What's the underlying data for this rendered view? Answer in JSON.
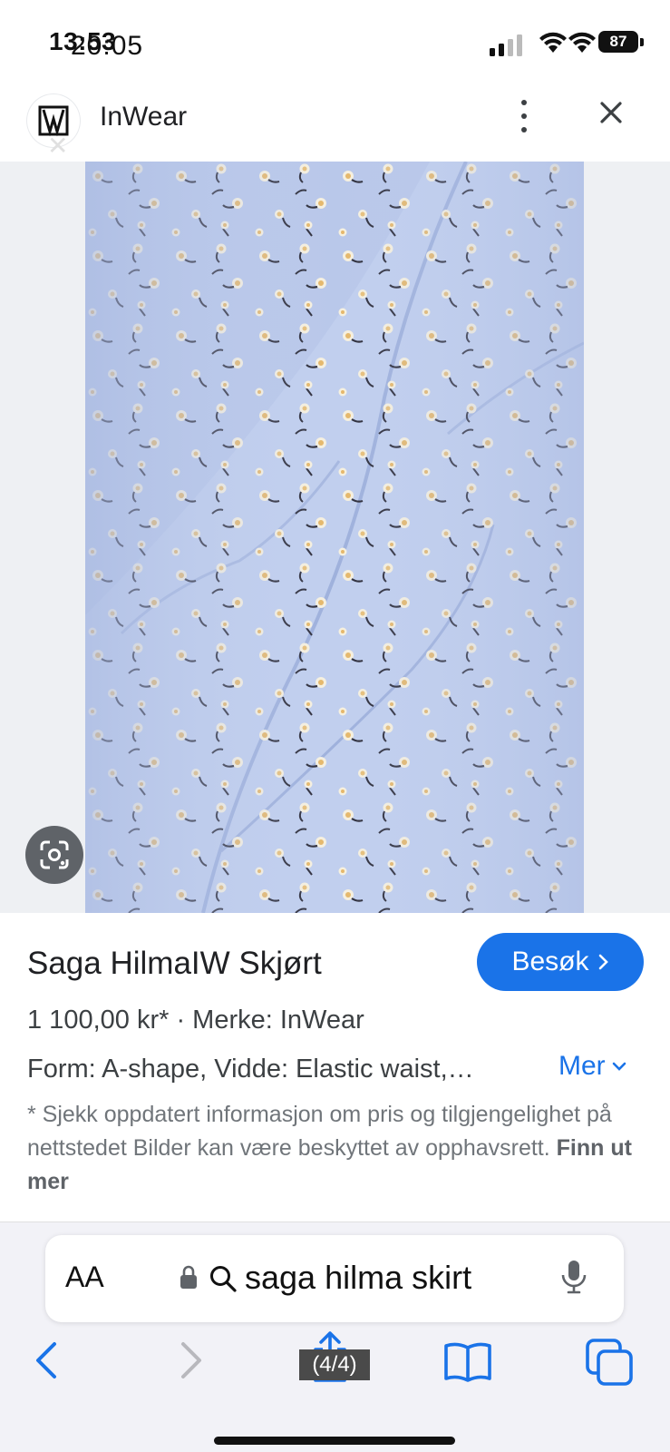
{
  "status_bar": {
    "time_overlay_a": "13:53",
    "time_overlay_b": "20:05",
    "battery": "87"
  },
  "header": {
    "site_name": "InWear"
  },
  "product": {
    "title": "Saga HilmaIW Skjørt",
    "visit_label": "Besøk",
    "price_line": "1 100,00 kr* · Merke: InWear",
    "form_line": "Form: A-shape, Vidde: Elastic waist,…",
    "more_label": "Mer",
    "disclaimer_text": "* Sjekk oppdatert informasjon om pris og tilgjengelighet på nettstedet Bilder kan være beskyttet av opphavsrett. ",
    "disclaimer_link": "Finn ut mer"
  },
  "browser": {
    "aa_label": "AA",
    "url_text": "saga hilma skirt",
    "page_counter": "(4/4)"
  },
  "colors": {
    "accent": "#1a73e8",
    "fabric": "#b9c8ea"
  },
  "icons": [
    "wifi-icon",
    "signal-icon",
    "battery-icon",
    "kebab-menu-icon",
    "close-icon",
    "google-lens-icon",
    "chevron-right-icon",
    "chevron-down-icon",
    "lock-icon",
    "search-icon",
    "microphone-icon",
    "back-arrow-icon",
    "forward-arrow-icon",
    "share-icon",
    "bookmarks-icon",
    "tabs-icon"
  ]
}
